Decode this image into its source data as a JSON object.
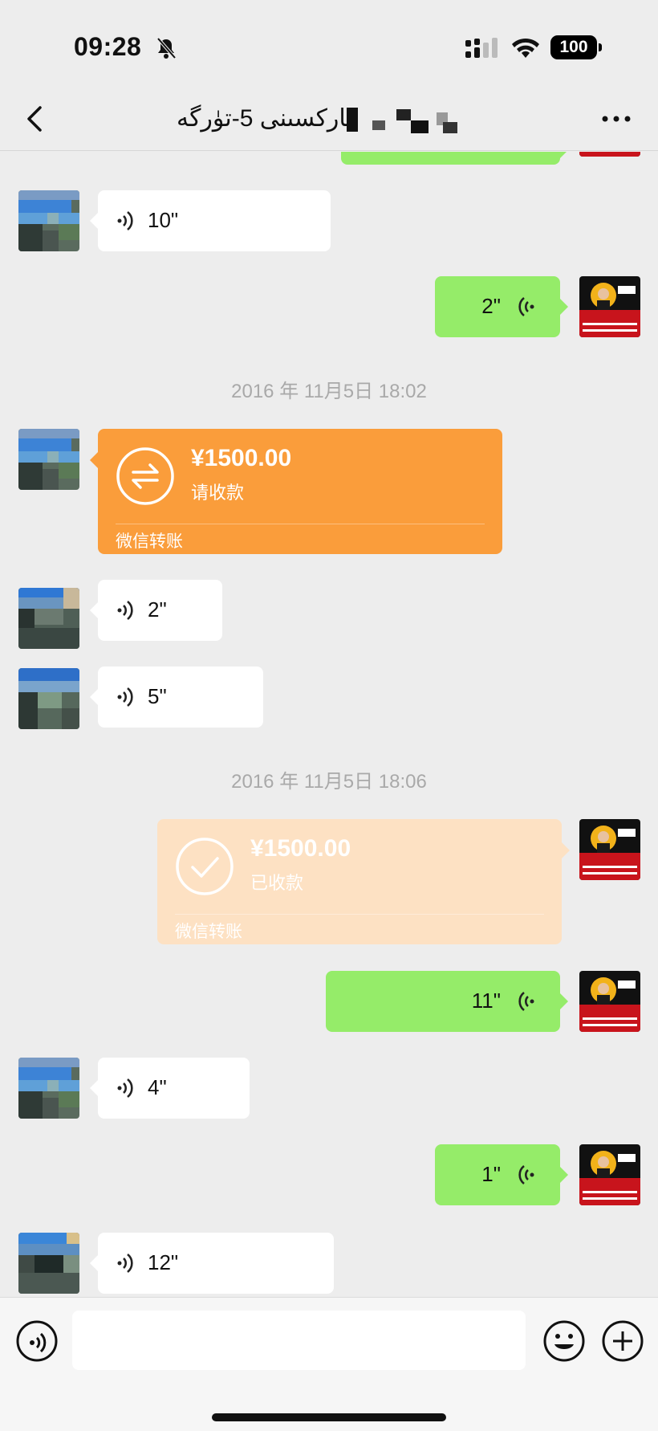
{
  "status_bar": {
    "time": "09:28",
    "battery": "100",
    "icons": [
      "bell-slash-icon",
      "cellular-signal-icon",
      "wifi-icon",
      "battery-icon"
    ]
  },
  "nav": {
    "title": "ئاركسىنى 5-تۈرگە",
    "back_icon": "chevron-left-icon",
    "more_icon": "ellipsis-icon"
  },
  "chat": {
    "messages": [
      {
        "side": "left",
        "type": "voice",
        "duration": "10\""
      },
      {
        "side": "right",
        "type": "voice",
        "duration": "2\""
      },
      {
        "type": "timestamp",
        "text": "2016 年 11月5日 18:02"
      },
      {
        "side": "left",
        "type": "transfer",
        "amount": "¥1500.00",
        "status": "请收款",
        "label": "微信转账"
      },
      {
        "side": "left",
        "type": "voice",
        "duration": "2\""
      },
      {
        "side": "left",
        "type": "voice",
        "duration": "5\""
      },
      {
        "type": "timestamp",
        "text": "2016 年 11月5日 18:06"
      },
      {
        "side": "right",
        "type": "transfer",
        "amount": "¥1500.00",
        "status": "已收款",
        "label": "微信转账"
      },
      {
        "side": "right",
        "type": "voice",
        "duration": "11\""
      },
      {
        "side": "left",
        "type": "voice",
        "duration": "4\""
      },
      {
        "side": "right",
        "type": "voice",
        "duration": "1\""
      },
      {
        "side": "left",
        "type": "voice",
        "duration": "12\""
      }
    ]
  },
  "input_bar": {
    "placeholder": "",
    "icons": [
      "voice-toggle-icon",
      "emoji-icon",
      "plus-icon"
    ]
  },
  "colors": {
    "background": "#ededed",
    "my_bubble": "#95ec69",
    "their_bubble": "#ffffff",
    "transfer_pending": "#fa9d3b",
    "transfer_done": "#fde1c3"
  }
}
